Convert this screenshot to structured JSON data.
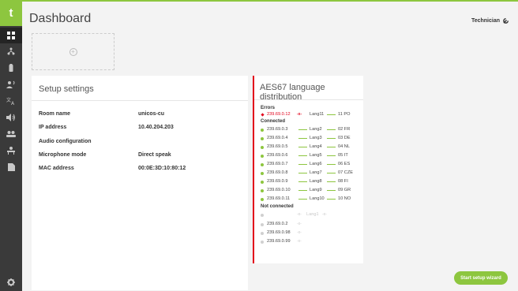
{
  "app": {
    "logo": "t"
  },
  "sidebar": {
    "items": [
      {
        "name": "dashboard",
        "icon": "dashboard-grid-icon",
        "active": true
      },
      {
        "name": "network",
        "icon": "network-icon"
      },
      {
        "name": "battery",
        "icon": "battery-icon"
      },
      {
        "name": "speaker",
        "icon": "speaker-person-icon"
      },
      {
        "name": "language",
        "icon": "translate-icon"
      },
      {
        "name": "volume",
        "icon": "volume-icon"
      },
      {
        "name": "users",
        "icon": "users-icon"
      },
      {
        "name": "conference",
        "icon": "conference-icon"
      },
      {
        "name": "document",
        "icon": "document-icon"
      }
    ],
    "settings_icon": "gear-icon"
  },
  "header": {
    "title": "Dashboard",
    "user": "Technician",
    "user_icon": "wrench-icon"
  },
  "add_tile": {
    "icon": "plus-circle-icon"
  },
  "setup_settings": {
    "title": "Setup settings",
    "rows": [
      {
        "label": "Room name",
        "value": "unicos-cu"
      },
      {
        "label": "IP address",
        "value": "10.40.204.203"
      },
      {
        "label": "Audio configuration",
        "value": ""
      },
      {
        "label": "Microphone mode",
        "value": "Direct speak"
      },
      {
        "label": "MAC address",
        "value": "00:0E:3D:10:80:12"
      }
    ]
  },
  "aes67": {
    "title": "AES67 language distribution",
    "errors_label": "Errors",
    "errors": [
      {
        "ip": "239.69.0.12",
        "lang": "Lang11",
        "out": "11 PO"
      }
    ],
    "connected_label": "Connected",
    "connected": [
      {
        "ip": "239.69.0.3",
        "lang": "Lang2",
        "out": "02 FR"
      },
      {
        "ip": "239.69.0.4",
        "lang": "Lang3",
        "out": "03 DE"
      },
      {
        "ip": "239.69.0.5",
        "lang": "Lang4",
        "out": "04 NL"
      },
      {
        "ip": "239.69.0.6",
        "lang": "Lang5",
        "out": "05 IT"
      },
      {
        "ip": "239.69.0.7",
        "lang": "Lang6",
        "out": "06 ES"
      },
      {
        "ip": "239.69.0.8",
        "lang": "Lang7",
        "out": "07 CZE"
      },
      {
        "ip": "239.69.0.9",
        "lang": "Lang8",
        "out": "08 FI"
      },
      {
        "ip": "239.69.0.10",
        "lang": "Lang9",
        "out": "09 GR"
      },
      {
        "ip": "239.69.0.11",
        "lang": "Lang10",
        "out": "10 NO"
      }
    ],
    "not_connected_label": "Not connected",
    "not_connected": [
      {
        "ip": "",
        "lang": "Lang1"
      },
      {
        "ip": "239.69.0.2",
        "lang": ""
      },
      {
        "ip": "239.69.0.98",
        "lang": ""
      },
      {
        "ip": "239.69.0.99",
        "lang": ""
      }
    ]
  },
  "actions": {
    "start_wizard": "Start setup wizard"
  },
  "colors": {
    "accent": "#8dc63f",
    "error": "#e2001a",
    "sidebar": "#3a3a3a"
  }
}
